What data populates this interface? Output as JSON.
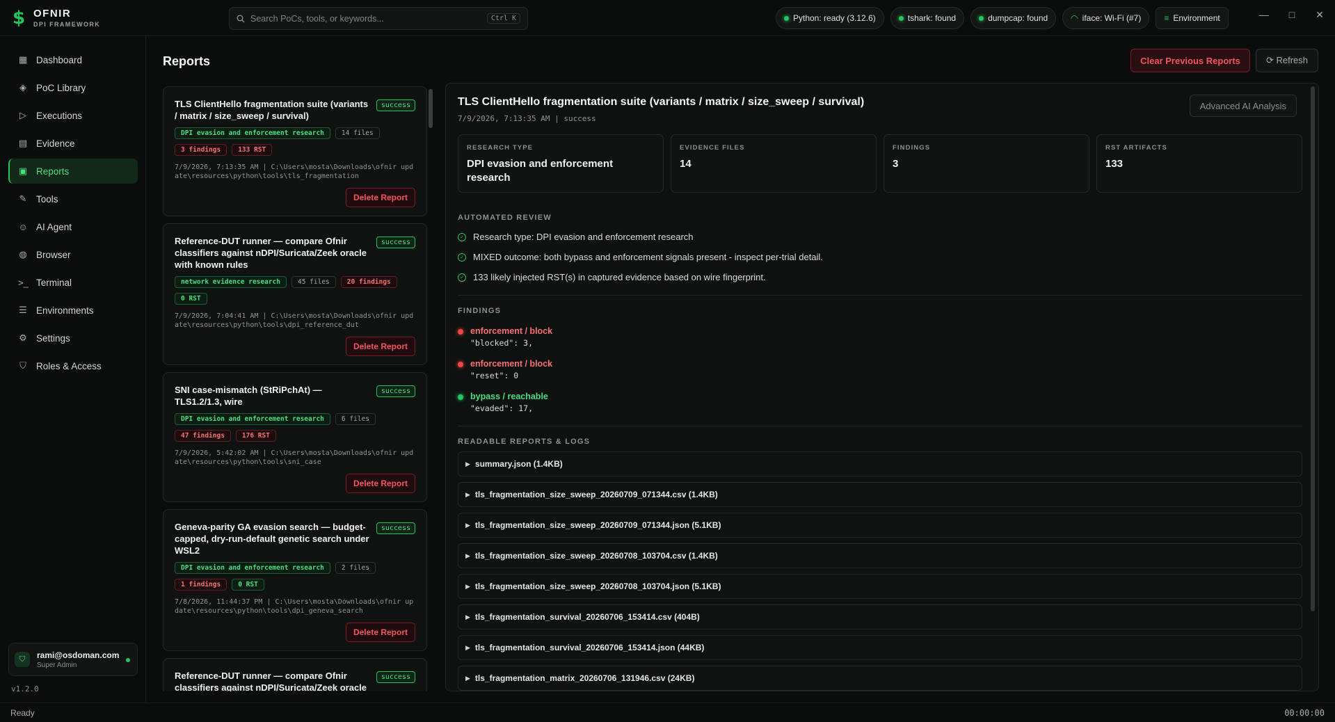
{
  "brand": {
    "name": "OFNIR",
    "subtitle": "DPI FRAMEWORK",
    "logo": "$"
  },
  "search": {
    "placeholder": "Search PoCs, tools, or keywords...",
    "shortcut": "Ctrl K"
  },
  "status_chips": [
    {
      "label": "Python: ready (3.12.6)"
    },
    {
      "label": "tshark: found"
    },
    {
      "label": "dumpcap: found"
    },
    {
      "label": "iface: Wi-Fi (#7)"
    },
    {
      "label": "Environment"
    }
  ],
  "window_controls": {
    "minimize": "—",
    "maximize": "□",
    "close": "✕"
  },
  "sidebar": {
    "items": [
      {
        "label": "Dashboard",
        "icon": "grid-icon"
      },
      {
        "label": "PoC Library",
        "icon": "layers-icon"
      },
      {
        "label": "Executions",
        "icon": "play-icon"
      },
      {
        "label": "Evidence",
        "icon": "archive-icon"
      },
      {
        "label": "Reports",
        "icon": "file-icon",
        "active": true
      },
      {
        "label": "Tools",
        "icon": "wrench-icon"
      },
      {
        "label": "AI Agent",
        "icon": "bot-icon"
      },
      {
        "label": "Browser",
        "icon": "globe-icon"
      },
      {
        "label": "Terminal",
        "icon": "terminal-icon"
      },
      {
        "label": "Environments",
        "icon": "server-icon"
      },
      {
        "label": "Settings",
        "icon": "gear-icon"
      },
      {
        "label": "Roles & Access",
        "icon": "shield-icon"
      }
    ],
    "user": {
      "email": "rami@osdoman.com",
      "role": "Super Admin"
    },
    "version": "v1.2.0"
  },
  "statusbar": {
    "left": "Ready",
    "right": "00:00:00"
  },
  "page": {
    "title": "Reports",
    "clear_label": "Clear Previous Reports",
    "refresh_label": "Refresh"
  },
  "reports": [
    {
      "title": "TLS ClientHello fragmentation suite (variants / matrix / size_sweep / survival)",
      "status": "success",
      "tags": [
        {
          "text": "DPI evasion and enforcement research",
          "kind": "green"
        },
        {
          "text": "14 files",
          "kind": "plain"
        },
        {
          "text": "3 findings",
          "kind": "red"
        },
        {
          "text": "133 RST",
          "kind": "red"
        }
      ],
      "meta": "7/9/2026, 7:13:35 AM | C:\\Users\\mosta\\Downloads\\ofnir update\\resources\\python\\tools\\tls_fragmentation",
      "delete_label": "Delete Report"
    },
    {
      "title": "Reference-DUT runner — compare Ofnir classifiers against nDPI/Suricata/Zeek oracle with known rules",
      "status": "success",
      "tags": [
        {
          "text": "network evidence research",
          "kind": "green"
        },
        {
          "text": "45 files",
          "kind": "plain"
        },
        {
          "text": "20 findings",
          "kind": "red"
        },
        {
          "text": "0 RST",
          "kind": "green"
        }
      ],
      "meta": "7/9/2026, 7:04:41 AM | C:\\Users\\mosta\\Downloads\\ofnir update\\resources\\python\\tools\\dpi_reference_dut",
      "delete_label": "Delete Report"
    },
    {
      "title": "SNI case-mismatch (StRiPchAt) — TLS1.2/1.3, wire",
      "status": "success",
      "tags": [
        {
          "text": "DPI evasion and enforcement research",
          "kind": "green"
        },
        {
          "text": "6 files",
          "kind": "plain"
        },
        {
          "text": "47 findings",
          "kind": "red"
        },
        {
          "text": "176 RST",
          "kind": "red"
        }
      ],
      "meta": "7/9/2026, 5:42:02 AM | C:\\Users\\mosta\\Downloads\\ofnir update\\resources\\python\\tools\\sni_case",
      "delete_label": "Delete Report"
    },
    {
      "title": "Geneva-parity GA evasion search — budget-capped, dry-run-default genetic search under WSL2",
      "status": "success",
      "tags": [
        {
          "text": "DPI evasion and enforcement research",
          "kind": "green"
        },
        {
          "text": "2 files",
          "kind": "plain"
        },
        {
          "text": "1 findings",
          "kind": "red"
        },
        {
          "text": "0 RST",
          "kind": "green"
        }
      ],
      "meta": "7/8/2026, 11:44:37 PM | C:\\Users\\mosta\\Downloads\\ofnir update\\resources\\python\\tools\\dpi_geneva_search",
      "delete_label": "Delete Report"
    },
    {
      "title": "Reference-DUT runner — compare Ofnir classifiers against nDPI/Suricata/Zeek oracle",
      "status": "success",
      "tags": [],
      "meta": "",
      "delete_label": ""
    }
  ],
  "detail": {
    "title": "TLS ClientHello fragmentation suite (variants / matrix / size_sweep / survival)",
    "subtitle": "7/9/2026, 7:13:35 AM | success",
    "ai_label": "Advanced AI Analysis",
    "stats": [
      {
        "label": "RESEARCH TYPE",
        "value": "DPI evasion and enforcement research"
      },
      {
        "label": "EVIDENCE FILES",
        "value": "14"
      },
      {
        "label": "FINDINGS",
        "value": "3"
      },
      {
        "label": "RST ARTIFACTS",
        "value": "133"
      }
    ],
    "review_heading": "AUTOMATED REVIEW",
    "review": [
      "Research type: DPI evasion and enforcement research",
      "MIXED outcome: both bypass and enforcement signals present - inspect per-trial detail.",
      "133 likely injected RST(s) in captured evidence based on wire fingerprint."
    ],
    "findings_heading": "FINDINGS",
    "findings": [
      {
        "title": "enforcement / block",
        "code": "\"blocked\": 3,",
        "kind": "red"
      },
      {
        "title": "enforcement / block",
        "code": "\"reset\": 0",
        "kind": "red"
      },
      {
        "title": "bypass / reachable",
        "code": "\"evaded\": 17,",
        "kind": "green"
      }
    ],
    "logs_heading": "READABLE REPORTS & LOGS",
    "logs": [
      "summary.json (1.4KB)",
      "tls_fragmentation_size_sweep_20260709_071344.csv (1.4KB)",
      "tls_fragmentation_size_sweep_20260709_071344.json (5.1KB)",
      "tls_fragmentation_size_sweep_20260708_103704.csv (1.4KB)",
      "tls_fragmentation_size_sweep_20260708_103704.json (5.1KB)",
      "tls_fragmentation_survival_20260706_153414.csv (404B)",
      "tls_fragmentation_survival_20260706_153414.json (44KB)",
      "tls_fragmentation_matrix_20260706_131946.csv (24KB)"
    ]
  }
}
